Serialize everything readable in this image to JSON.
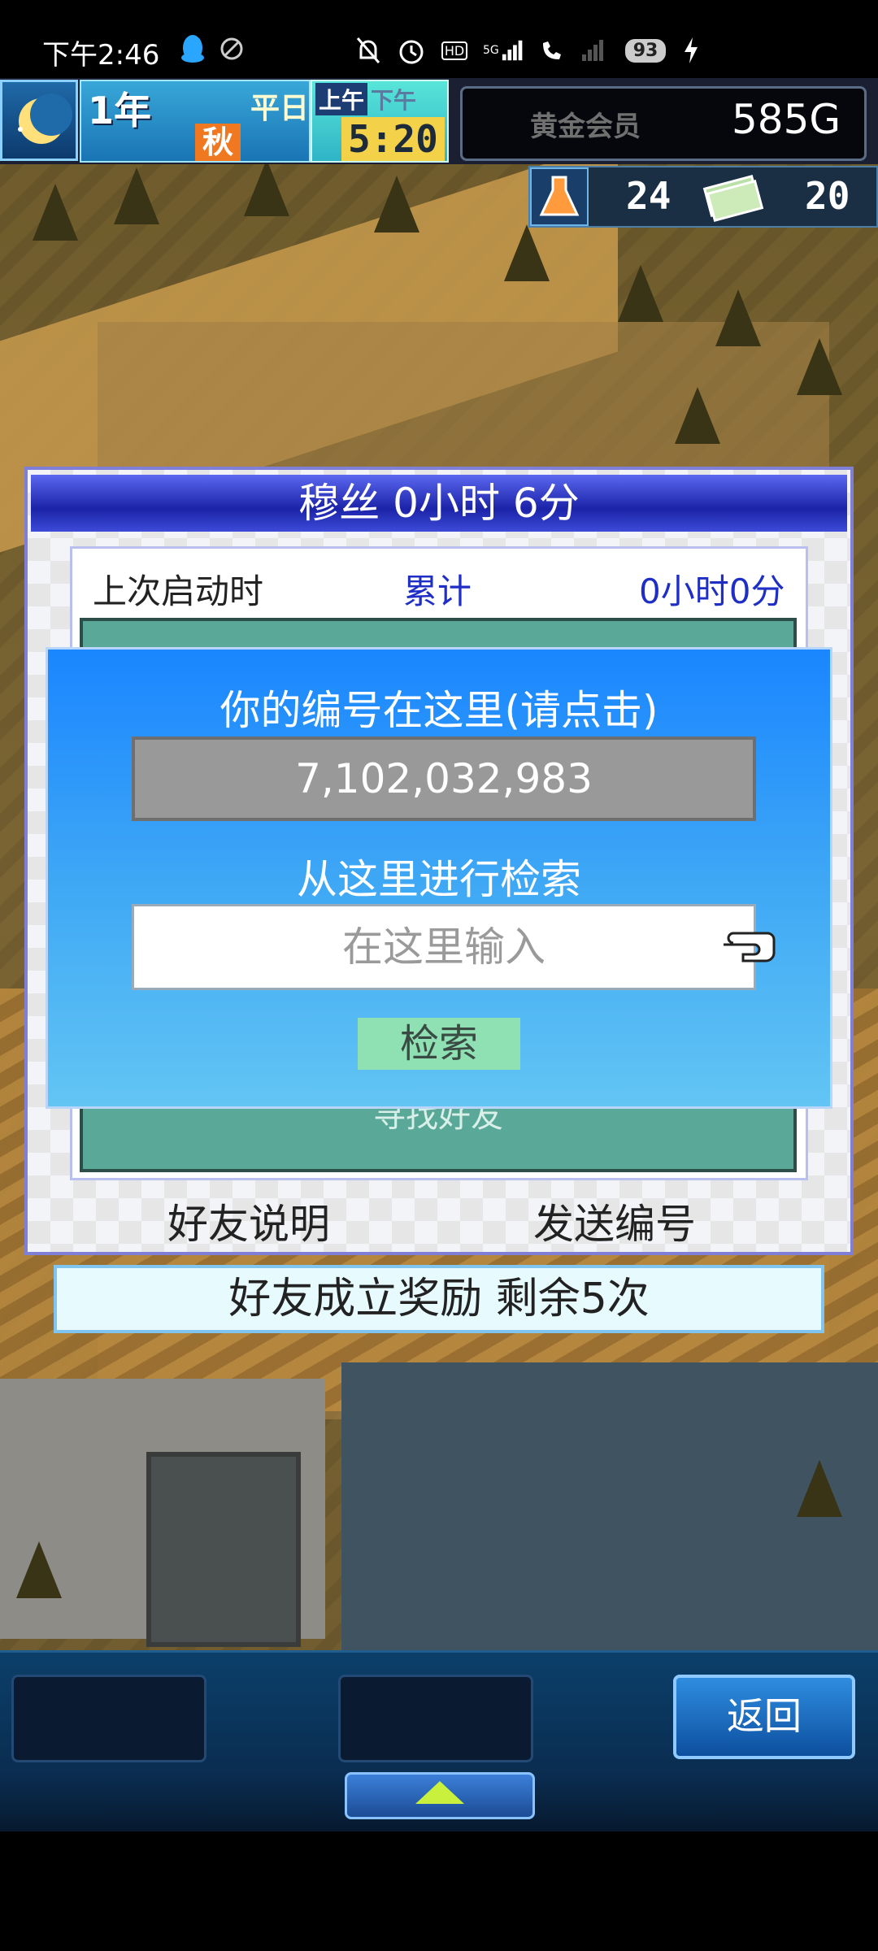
{
  "status_bar": {
    "time": "下午2:46",
    "battery": "93",
    "hd": "HD",
    "network": "5G"
  },
  "hud": {
    "year": "1年",
    "day_type": "平日",
    "season": "秋",
    "ampm_am": "上午",
    "ampm_pm": "下午",
    "clock": "5:20",
    "member_label": "黄金会员",
    "gold": "585G",
    "research_points": "24",
    "money_points": "20"
  },
  "dialog": {
    "title": "穆丝  0小时 6分",
    "row_label": "上次启动时",
    "row_total_label": "累计",
    "row_total_value": "0小时0分",
    "find_friend": "寻找好友",
    "friend_explain": "好友说明",
    "send_id": "发送编号",
    "reward": "好友成立奖励  剩余5次"
  },
  "overlay": {
    "id_heading": "你的编号在这里(请点击)",
    "id_value": "7,102,032,983",
    "search_heading": "从这里进行检索",
    "search_placeholder": "在这里输入",
    "search_button": "检索"
  },
  "bottom_bar": {
    "back_button": "返回"
  },
  "colors": {
    "overlay_top": "#1a86ff",
    "overlay_bottom": "#62c5f4",
    "title_blue": "#1b23a8",
    "teal": "#5aa897"
  }
}
